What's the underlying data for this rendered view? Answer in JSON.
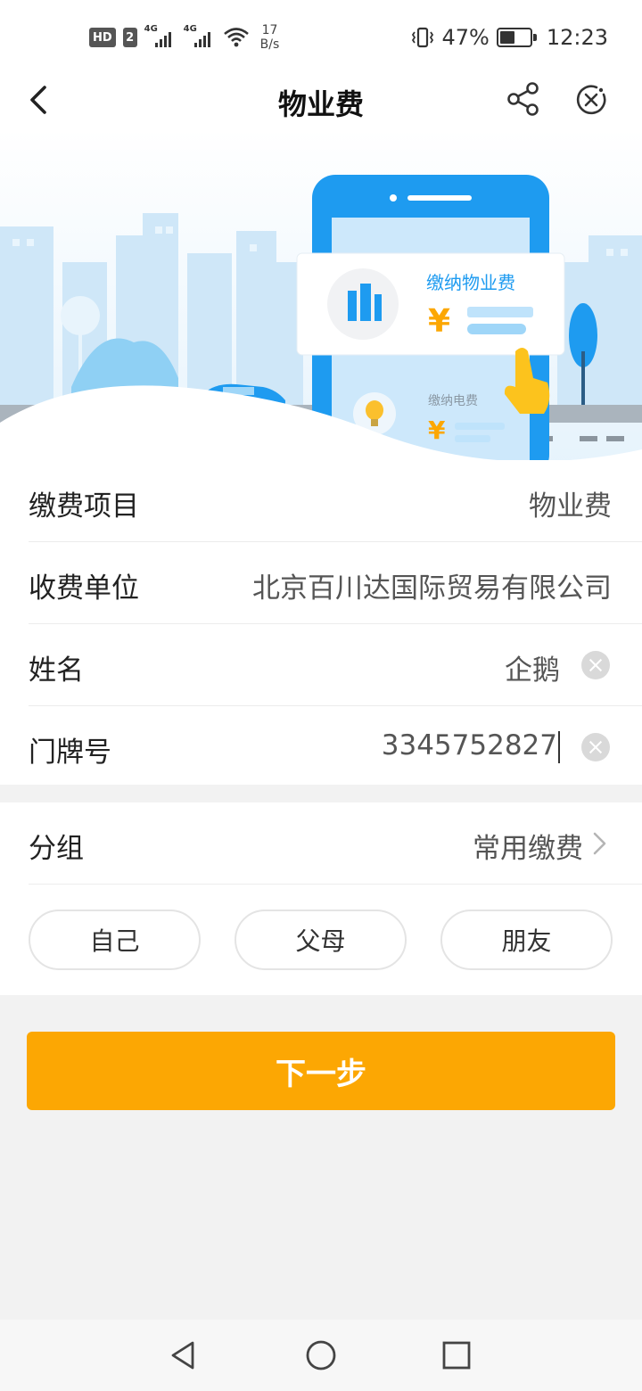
{
  "status_bar": {
    "hd_label": "HD",
    "hd_sim": "2",
    "signal_tag_1": "4G",
    "signal_tag_2": "4G",
    "net_speed_value": "17",
    "net_speed_unit": "B/s",
    "battery_percent": "47%",
    "battery_level": 0.47,
    "time": "12:23"
  },
  "header": {
    "title": "物业费",
    "back_icon": "back-arrow-icon",
    "share_icon": "share-icon",
    "close_icon": "close-circle-icon"
  },
  "banner": {
    "card_title": "缴纳物业费",
    "card_currency": "¥",
    "secondary_title": "缴纳电费",
    "secondary_currency": "¥",
    "accent_color": "#1e9bf0"
  },
  "form": {
    "items": [
      {
        "label": "缴费项目",
        "value": "物业费"
      },
      {
        "label": "收费单位",
        "value": "北京百川达国际贸易有限公司"
      },
      {
        "label": "姓名",
        "value": "企鹅"
      },
      {
        "label": "门牌号",
        "value": "3345752827"
      }
    ]
  },
  "group": {
    "label": "分组",
    "value": "常用缴费",
    "chips": [
      "自己",
      "父母",
      "朋友"
    ]
  },
  "next_button": {
    "label": "下一步",
    "color": "#fca703"
  },
  "nav": {
    "back": "triangle-back-icon",
    "home": "circle-home-icon",
    "recents": "square-recents-icon"
  }
}
